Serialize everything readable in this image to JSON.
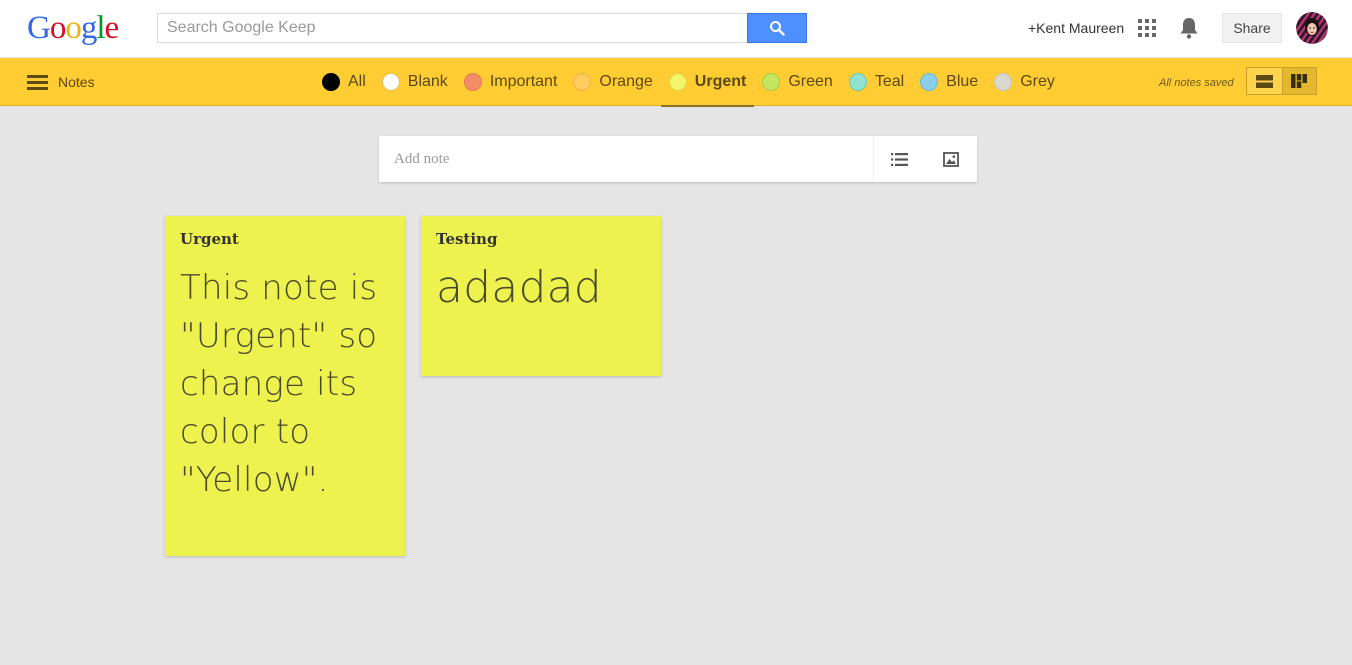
{
  "header": {
    "logo_letters": [
      {
        "char": "G",
        "color": "#3369e8"
      },
      {
        "char": "o",
        "color": "#d50f25"
      },
      {
        "char": "o",
        "color": "#eeb211"
      },
      {
        "char": "g",
        "color": "#3369e8"
      },
      {
        "char": "l",
        "color": "#009925"
      },
      {
        "char": "e",
        "color": "#d50f25"
      }
    ],
    "search_placeholder": "Search Google Keep",
    "search_icon": "search-icon",
    "user_name": "+Kent Maureen",
    "apps_icon": "apps-grid-icon",
    "notifications_icon": "bell-icon",
    "share_label": "Share",
    "avatar_icon": "avatar"
  },
  "toolbar": {
    "menu_icon": "hamburger-icon",
    "section_label": "Notes",
    "filters": [
      {
        "label": "All",
        "color": "#000000",
        "border": "#000000",
        "active": false
      },
      {
        "label": "Blank",
        "color": "#ffffff",
        "border": "#e0c060",
        "active": false
      },
      {
        "label": "Important",
        "color": "#f28b68",
        "border": "#e07a58",
        "active": false
      },
      {
        "label": "Orange",
        "color": "#ffcc5e",
        "border": "#f0b040",
        "active": false
      },
      {
        "label": "Urgent",
        "color": "#f4f46a",
        "border": "#e0d040",
        "active": true
      },
      {
        "label": "Green",
        "color": "#c3e75e",
        "border": "#a8cc48",
        "active": false
      },
      {
        "label": "Teal",
        "color": "#8ee2cf",
        "border": "#70c8b5",
        "active": false
      },
      {
        "label": "Blue",
        "color": "#8ad0ea",
        "border": "#6cb8d4",
        "active": false
      },
      {
        "label": "Grey",
        "color": "#d8d8d0",
        "border": "#c4c4bc",
        "active": false
      }
    ],
    "save_status": "All notes saved",
    "views": [
      {
        "icon": "list-view-icon",
        "active": false
      },
      {
        "icon": "grid-view-icon",
        "active": true
      }
    ]
  },
  "add_note": {
    "placeholder": "Add note",
    "list_icon": "checklist-icon",
    "image_icon": "image-icon"
  },
  "notes": [
    {
      "title": "Urgent",
      "body": "This note is \"Urgent\" so change its color to \"Yellow\".",
      "color": "#eef24e"
    },
    {
      "title": "Testing",
      "body": "adadad",
      "color": "#eef24e"
    }
  ]
}
